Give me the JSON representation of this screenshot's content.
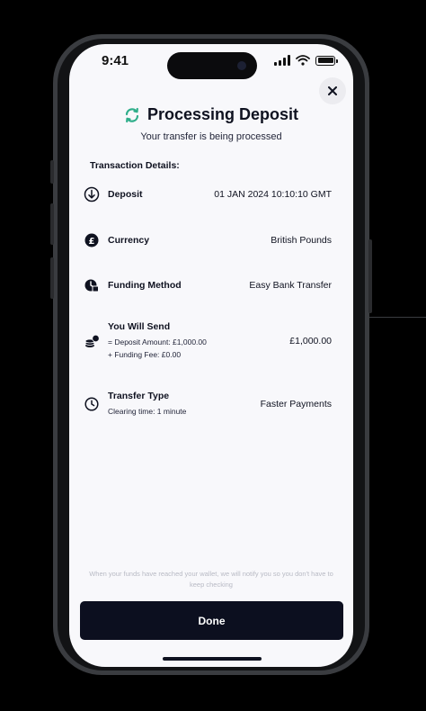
{
  "status_bar": {
    "time": "9:41"
  },
  "header": {
    "title": "Processing Deposit",
    "subtitle": "Your transfer is being processed"
  },
  "section_label": "Transaction Details:",
  "rows": [
    {
      "icon": "arrow-down-circle-icon",
      "label": "Deposit",
      "value": "01 JAN 2024 10:10:10 GMT"
    },
    {
      "icon": "pound-coin-icon",
      "label": "Currency",
      "value": "British Pounds"
    },
    {
      "icon": "funding-method-icon",
      "label": "Funding Method",
      "value": "Easy Bank Transfer"
    },
    {
      "icon": "coins-stack-icon",
      "label": "You Will Send",
      "sub1": "= Deposit Amount: £1,000.00",
      "sub2": "+ Funding Fee: £0.00",
      "value": "£1,000.00"
    },
    {
      "icon": "clock-icon",
      "label": "Transfer Type",
      "sub1": "Clearing time: 1 minute",
      "value": "Faster Payments"
    }
  ],
  "footer_note": "When your funds have reached your wallet, we will notify you so you don't have to keep checking",
  "done_label": "Done",
  "colors": {
    "accent": "#2fae8a",
    "button": "#0c0f1f",
    "background": "#f8f8fb"
  }
}
